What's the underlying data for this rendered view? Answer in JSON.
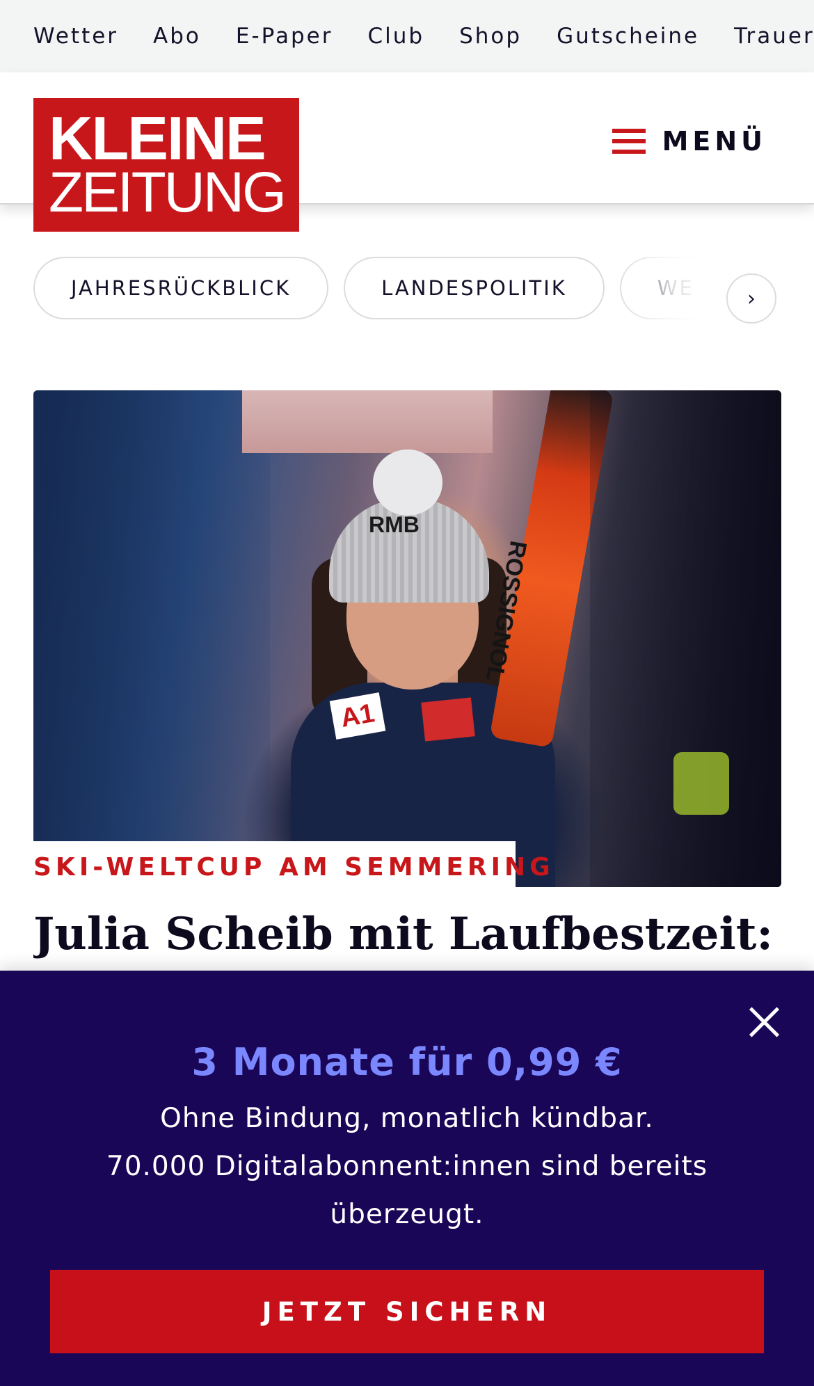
{
  "topnav": {
    "items": [
      {
        "label": "Wetter"
      },
      {
        "label": "Abo"
      },
      {
        "label": "E-Paper"
      },
      {
        "label": "Club"
      },
      {
        "label": "Shop"
      },
      {
        "label": "Gutscheine"
      },
      {
        "label": "Trauerportal"
      }
    ]
  },
  "header": {
    "logo_line1": "KLEINE",
    "logo_line2": "ZEITUNG",
    "menu_label": "MENÜ",
    "brand_color": "#c8171b"
  },
  "categories": {
    "pills": [
      {
        "label": "JAHRESRÜCKBLICK"
      },
      {
        "label": "LANDESPOLITIK"
      },
      {
        "label": "WE"
      }
    ],
    "next_icon": "chevron-right-icon"
  },
  "article": {
    "kicker": "SKI-WELTCUP AM SEMMERING",
    "headline": "Julia Scheib mit Laufbestzeit:",
    "image_text": {
      "hat": "RMB",
      "ski": "ROSSIGNOL",
      "sponsor": "A1"
    }
  },
  "promo": {
    "title": "3 Monate für 0,99 €",
    "line1": "Ohne Bindung, monatlich kündbar.",
    "line2": "70.000 Digitalabonnent:innen sind bereits überzeugt.",
    "cta_label": "JETZT SICHERN",
    "close_icon": "close-icon",
    "background_color": "#1a0657",
    "title_color": "#7b87ff",
    "cta_color": "#c8101b"
  }
}
